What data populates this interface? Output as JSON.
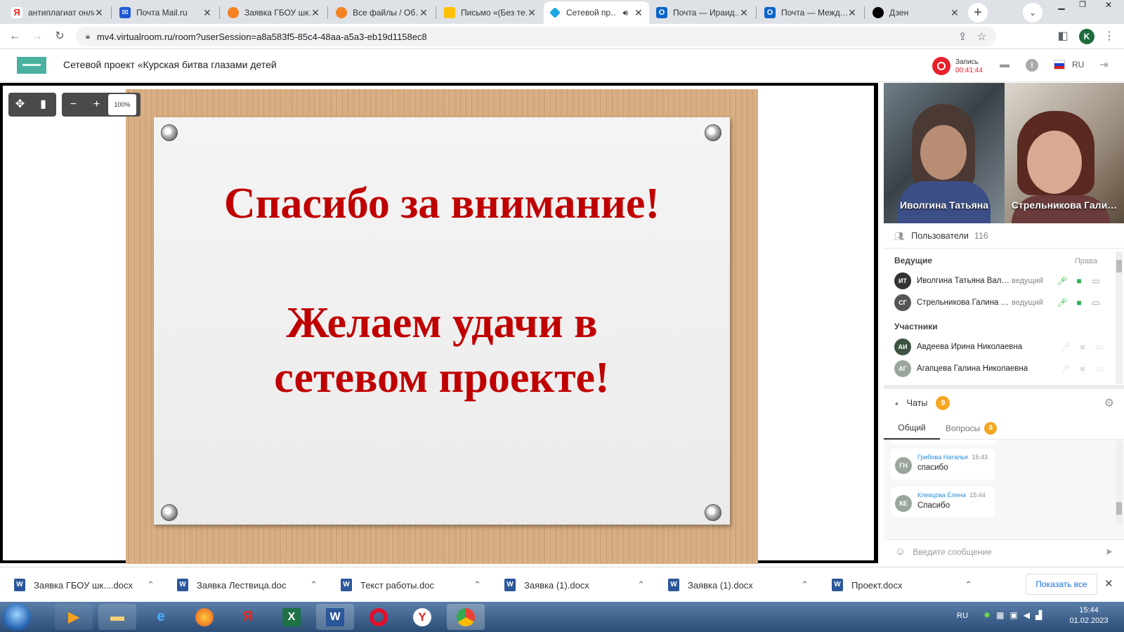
{
  "browser": {
    "tabs": [
      {
        "title": "антиплагиат онлайн",
        "color": "#e52620",
        "glyph": "Я"
      },
      {
        "title": "Почта Mail.ru",
        "color": "#1f5ad5",
        "glyph": "✉"
      },
      {
        "title": "Заявка ГБОУ шк…",
        "color": "#f58220",
        "glyph": "☁"
      },
      {
        "title": "Все файлы / Об…",
        "color": "#f58220",
        "glyph": "☁"
      },
      {
        "title": "Письмо «(Без те…",
        "color": "#ffc107",
        "glyph": "✉"
      },
      {
        "title": "Сетевой пр…",
        "color": "#1aa6e0",
        "glyph": "◆",
        "active": true
      },
      {
        "title": "Почта — Ираид…",
        "color": "#0a64c8",
        "glyph": "O"
      },
      {
        "title": "Почта — Межд…",
        "color": "#0a64c8",
        "glyph": "O"
      },
      {
        "title": "Дзен",
        "color": "#000000",
        "glyph": "✦"
      }
    ],
    "url": "mv4.virtualroom.ru/room?userSession=a8a583f5-85c4-48aa-a5a3-eb19d1158ec8",
    "profile_letter": "K"
  },
  "app": {
    "title": "Сетевой проект «Курская битва глазами детей",
    "record_label": "Запись",
    "record_time": "00:41:44",
    "lang": "RU"
  },
  "board": {
    "zoom": "100%",
    "slide_line1": "Спасибо за внимание!",
    "slide_line2": "Желаем удачи в",
    "slide_line3": "сетевом проекте!"
  },
  "videos": [
    {
      "name": "Иволгина Татьяна"
    },
    {
      "name": "Стрельникова Гали…"
    }
  ],
  "users": {
    "title": "Пользователи",
    "count": "116",
    "hosts_label": "Ведущие",
    "rights_label": "Права",
    "hosts": [
      {
        "initials": "ИТ",
        "name": "Иволгина Татьяна Вал…",
        "role": "ведущий"
      },
      {
        "initials": "СГ",
        "name": "Стрельникова Галина …",
        "role": "ведущий"
      }
    ],
    "participants_label": "Участники",
    "participants": [
      {
        "initials": "АИ",
        "name": "Авдеева Ирина Николаевна"
      },
      {
        "initials": "АГ",
        "name": "Агапцева Галина Николаевна"
      }
    ]
  },
  "chat": {
    "title": "Чаты",
    "badge": "9",
    "tab_general": "Общий",
    "tab_questions": "Вопросы",
    "questions_badge": "9",
    "messages": [
      {
        "initials": "ГН",
        "author": "Грибова Наталья",
        "time": "15:43",
        "text": "спасибо"
      },
      {
        "initials": "КЕ",
        "author": "Клевцова Елена",
        "time": "15:44",
        "text": "Спасибо"
      }
    ],
    "input_placeholder": "Введите сообщение"
  },
  "downloads": {
    "items": [
      "Заявка ГБОУ шк....docx",
      "Заявка Лествица.doc",
      "Текст работы.doc",
      "Заявка (1).docx",
      "Заявка (1).docx",
      "Проект.docx"
    ],
    "show_all": "Показать все"
  },
  "taskbar": {
    "lang": "RU",
    "time": "15:44",
    "date": "01.02.2023"
  }
}
